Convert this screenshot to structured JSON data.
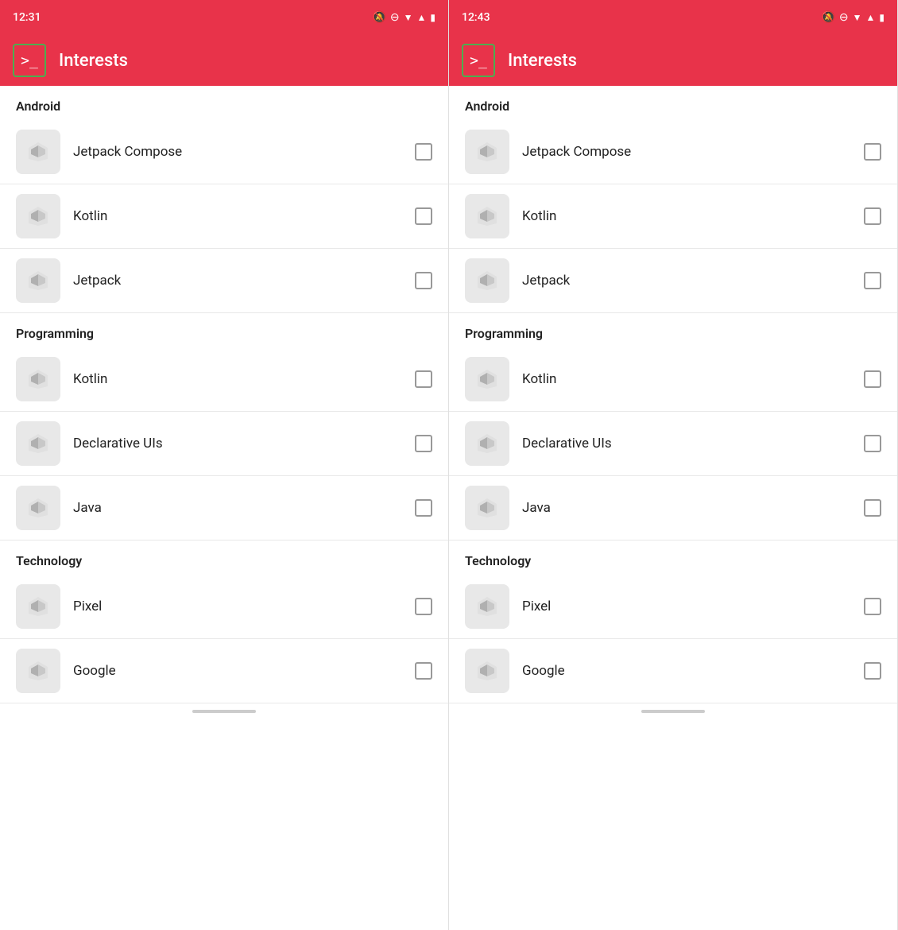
{
  "panels": [
    {
      "id": "panel-left",
      "statusBar": {
        "time": "12:31",
        "icons": [
          "🔔̸",
          "⊖",
          "▾▲",
          "🔋"
        ]
      },
      "appBar": {
        "title": "Interests",
        "iconLabel": ">_"
      },
      "sections": [
        {
          "id": "android-left",
          "label": "Android",
          "items": [
            {
              "id": "jetpack-compose-left",
              "label": "Jetpack Compose",
              "checked": false
            },
            {
              "id": "kotlin-left-1",
              "label": "Kotlin",
              "checked": false
            },
            {
              "id": "jetpack-left",
              "label": "Jetpack",
              "checked": false
            }
          ]
        },
        {
          "id": "programming-left",
          "label": "Programming",
          "items": [
            {
              "id": "kotlin-left-2",
              "label": "Kotlin",
              "checked": false
            },
            {
              "id": "declarative-left",
              "label": "Declarative UIs",
              "checked": false
            },
            {
              "id": "java-left",
              "label": "Java",
              "checked": false
            }
          ]
        },
        {
          "id": "technology-left",
          "label": "Technology",
          "items": [
            {
              "id": "pixel-left",
              "label": "Pixel",
              "checked": false
            },
            {
              "id": "google-left",
              "label": "Google",
              "checked": false
            }
          ]
        }
      ]
    },
    {
      "id": "panel-right",
      "statusBar": {
        "time": "12:43",
        "icons": [
          "🔔̸",
          "⊖",
          "▾▲",
          "🔋"
        ]
      },
      "appBar": {
        "title": "Interests",
        "iconLabel": ">_"
      },
      "sections": [
        {
          "id": "android-right",
          "label": "Android",
          "items": [
            {
              "id": "jetpack-compose-right",
              "label": "Jetpack Compose",
              "checked": false
            },
            {
              "id": "kotlin-right-1",
              "label": "Kotlin",
              "checked": false
            },
            {
              "id": "jetpack-right",
              "label": "Jetpack",
              "checked": false
            }
          ]
        },
        {
          "id": "programming-right",
          "label": "Programming",
          "items": [
            {
              "id": "kotlin-right-2",
              "label": "Kotlin",
              "checked": false
            },
            {
              "id": "declarative-right",
              "label": "Declarative UIs",
              "checked": false
            },
            {
              "id": "java-right",
              "label": "Java",
              "checked": false
            }
          ]
        },
        {
          "id": "technology-right",
          "label": "Technology",
          "items": [
            {
              "id": "pixel-right",
              "label": "Pixel",
              "checked": false
            },
            {
              "id": "google-right",
              "label": "Google",
              "checked": false
            }
          ]
        }
      ]
    }
  ],
  "colors": {
    "primary": "#e8334a",
    "greenBorder": "#4caf50",
    "iconBg": "#e0e0e0"
  }
}
